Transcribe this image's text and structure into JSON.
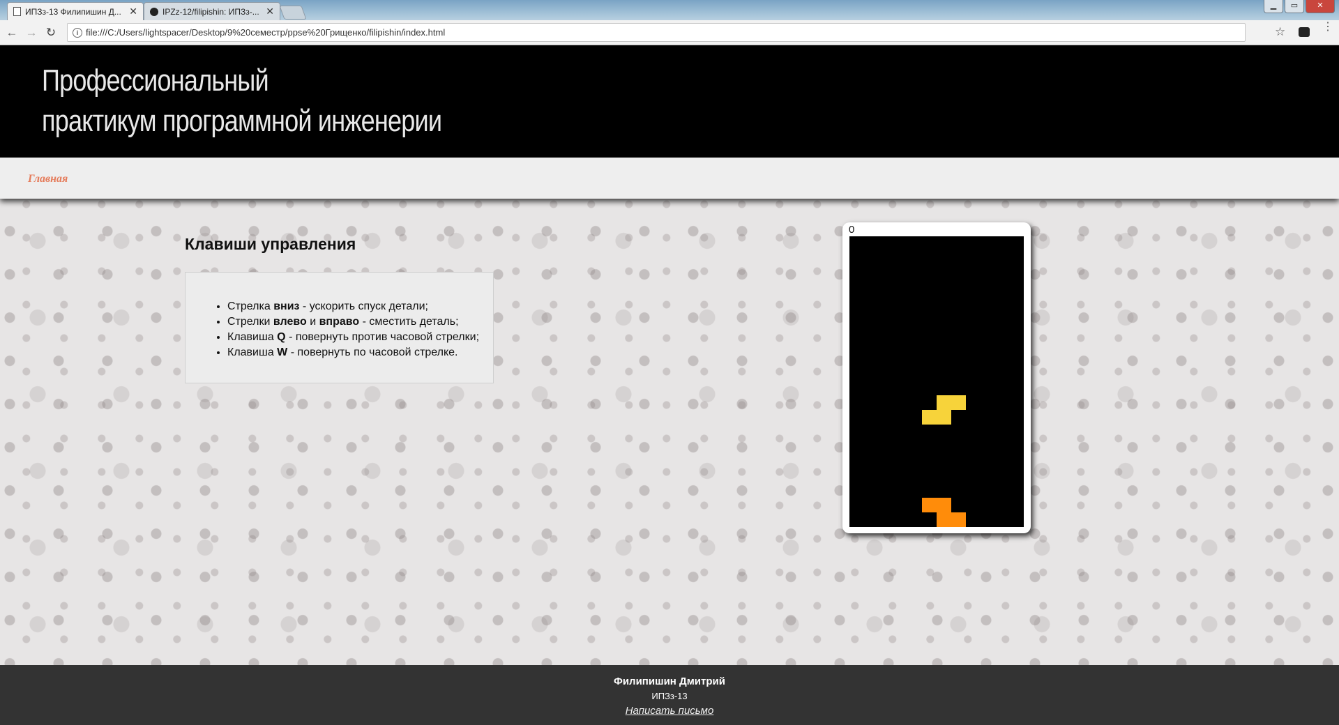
{
  "browser": {
    "tabs": [
      {
        "title": "ИПЗз-13 Филипишин Д...",
        "active": true
      },
      {
        "title": "IPZz-12/filipishin: ИПЗз-...",
        "active": false
      }
    ],
    "window_controls": [
      "▁",
      "▭",
      "✕"
    ],
    "address": "file:///C:/Users/lightspacer/Desktop/9%20семестр/ppse%20Грищенко/filipishin/index.html",
    "info_icon_glyph": "i",
    "back_glyph": "←",
    "forward_glyph": "→",
    "reload_glyph": "↻",
    "star_glyph": "☆",
    "menu_glyph": "⋮"
  },
  "site": {
    "title_line1": "Профессиональный",
    "title_line2": "практикум программной инженерии",
    "nav_home": "Главная"
  },
  "controls": {
    "heading": "Клавиши управления",
    "items": [
      {
        "pre": "Стрелка ",
        "key": "вниз",
        "post": " - ускорить спуск детали;"
      },
      {
        "pre": "Стрелки ",
        "key": "влево",
        "mid": " и ",
        "key2": "вправо",
        "post": " - сместить деталь;"
      },
      {
        "pre": "Клавиша ",
        "key": "Q",
        "post": " - повернуть против часовой стрелки;"
      },
      {
        "pre": "Клавиша ",
        "key": "W",
        "post": " - повернуть по часовой стрелке."
      }
    ]
  },
  "game": {
    "score": "0",
    "colors": {
      "falling_piece": "#f7d33a",
      "landed_piece": "#ff8c0a",
      "board": "#000000"
    }
  },
  "footer": {
    "name": "Филипишин Дмитрий",
    "group": "ИПЗз-13",
    "mail_link": "Написать письмо"
  }
}
